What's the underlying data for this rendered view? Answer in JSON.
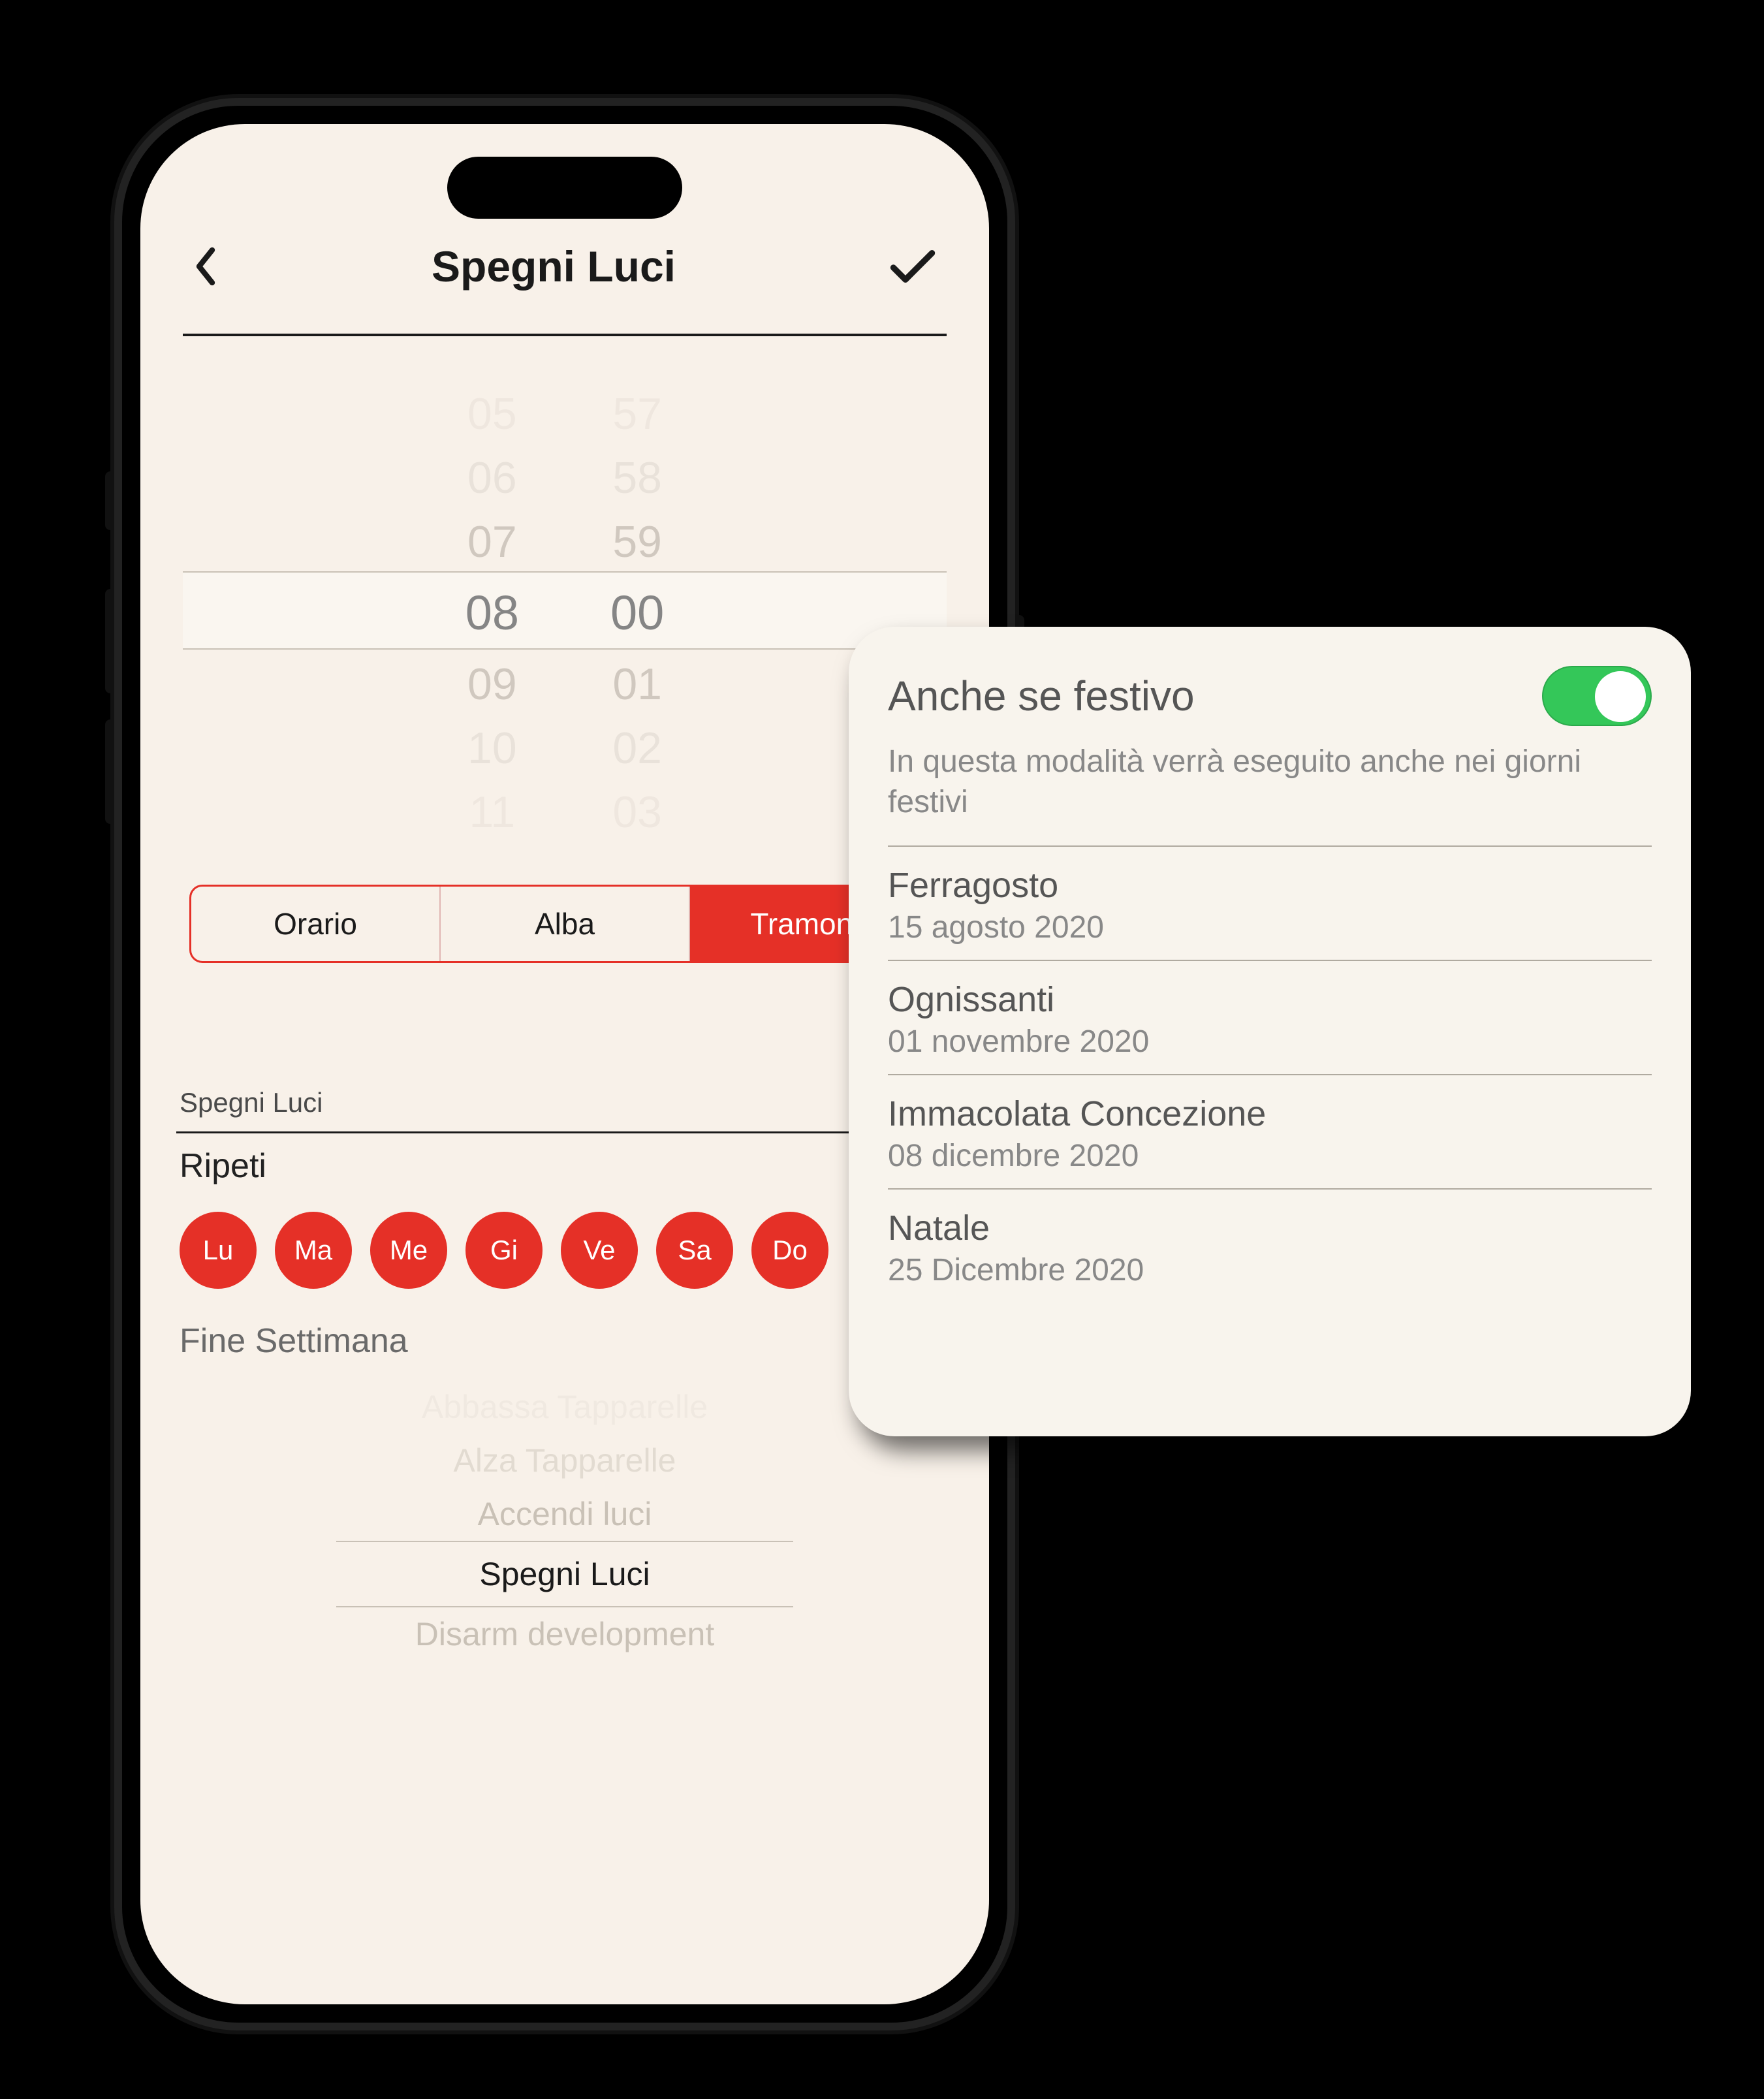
{
  "header": {
    "title": "Spegni Luci"
  },
  "picker": {
    "hours": [
      "05",
      "06",
      "07",
      "08",
      "09",
      "10",
      "11"
    ],
    "mins": [
      "57",
      "58",
      "59",
      "00",
      "01",
      "02",
      "03"
    ]
  },
  "segmented": {
    "options": [
      "Orario",
      "Alba",
      "Tramonto"
    ],
    "active_index": 2
  },
  "label": "Spegni Luci",
  "repeat": {
    "title": "Ripeti",
    "days": [
      "Lu",
      "Ma",
      "Me",
      "Gi",
      "Ve",
      "Sa",
      "Do"
    ]
  },
  "weekend": "Fine Settimana",
  "scenarios": {
    "items": [
      "Abbassa Tapparelle",
      "Alza Tapparelle",
      "Accendi luci",
      "Spegni Luci",
      "Disarm development"
    ],
    "selected_index": 3
  },
  "holiday_card": {
    "title": "Anche se festivo",
    "description": "In questa modalità verrà eseguito anche nei giorni festivi",
    "toggle_on": true,
    "items": [
      {
        "name": "Ferragosto",
        "date": "15 agosto 2020"
      },
      {
        "name": "Ognissanti",
        "date": "01 novembre 2020"
      },
      {
        "name": "Immacolata Concezione",
        "date": "08 dicembre 2020"
      },
      {
        "name": "Natale",
        "date": "25 Dicembre 2020"
      }
    ]
  }
}
